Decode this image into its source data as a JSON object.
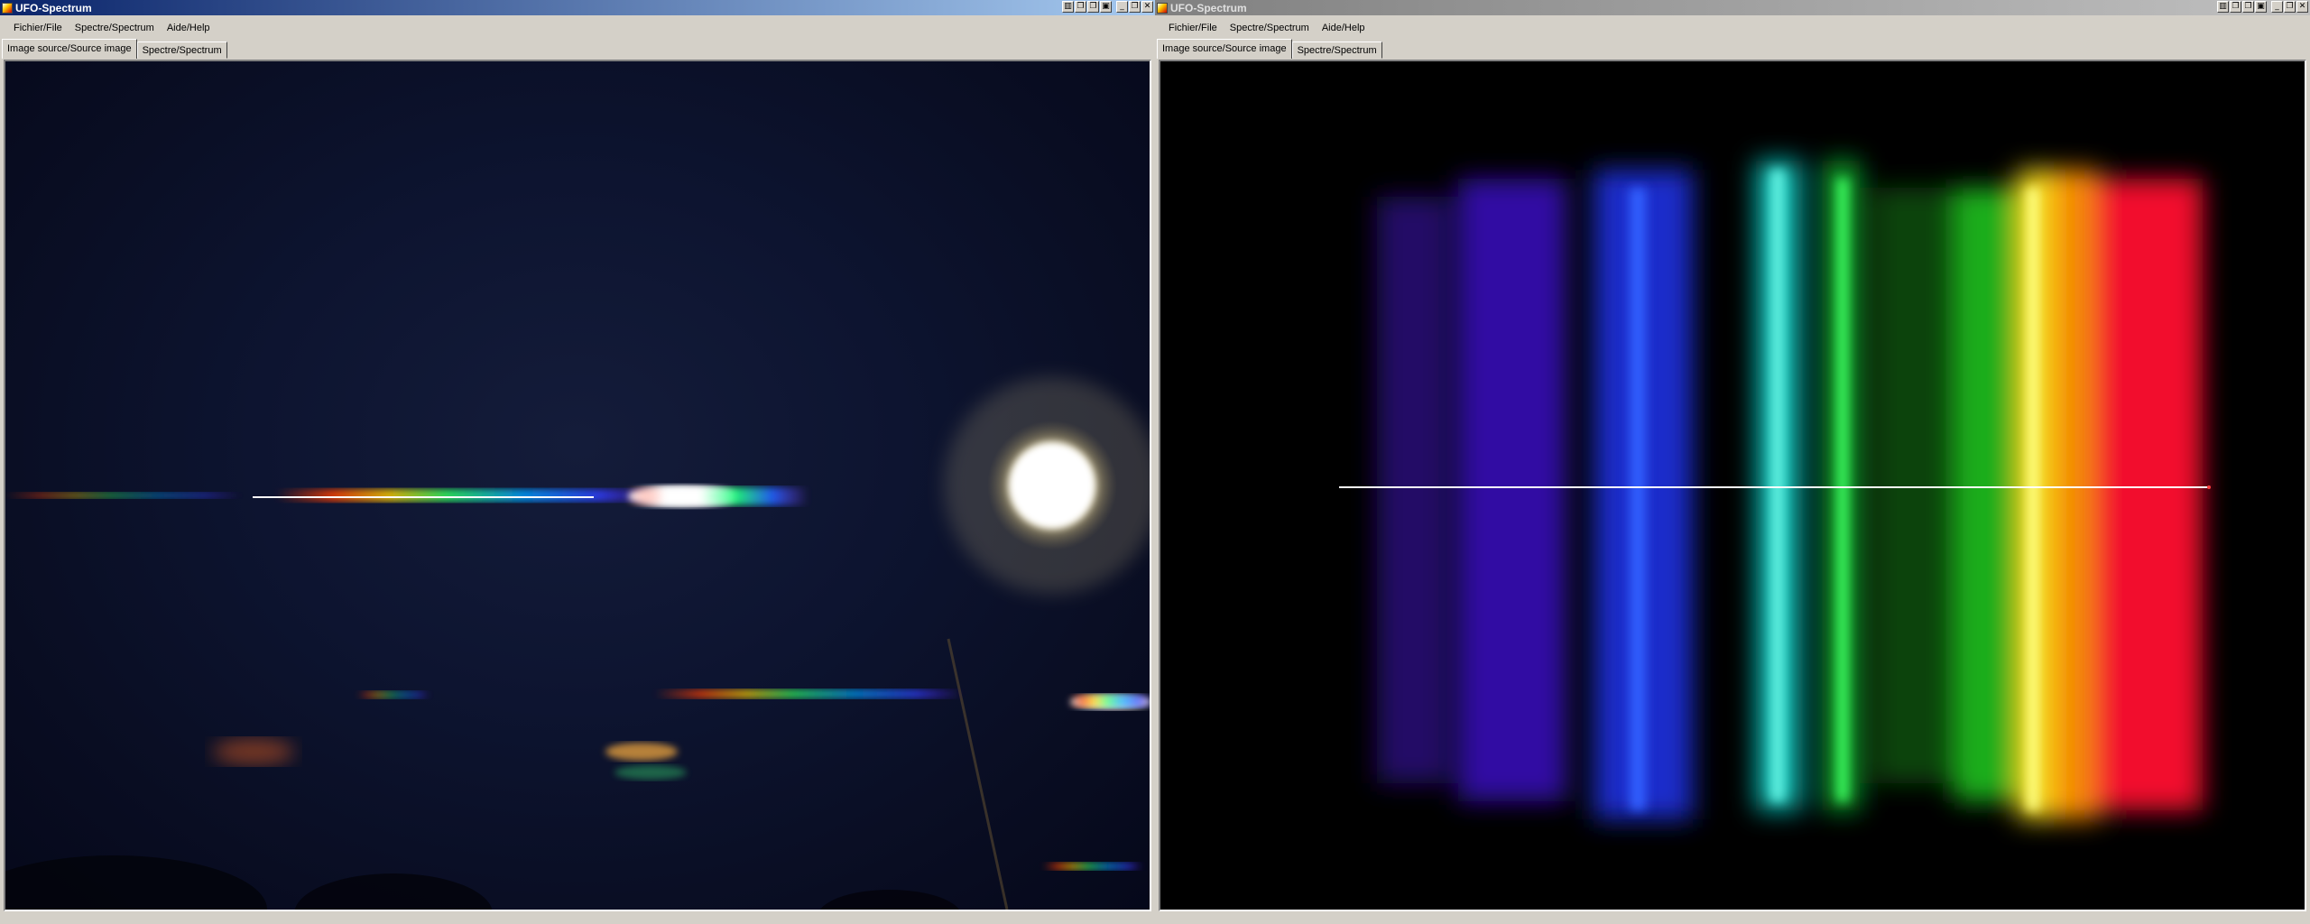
{
  "windows": [
    {
      "title": "UFO-Spectrum",
      "active": true,
      "menu": [
        "Fichier/File",
        "Spectre/Spectrum",
        "Aide/Help"
      ],
      "tabs": [
        "Image source/Source image",
        "Spectre/Spectrum"
      ],
      "selected_tab": 0
    },
    {
      "title": "UFO-Spectrum",
      "active": false,
      "menu": [
        "Fichier/File",
        "Spectre/Spectrum",
        "Aide/Help"
      ],
      "tabs": [
        "Image source/Source image",
        "Spectre/Spectrum"
      ],
      "selected_tab": 0
    }
  ],
  "icons": {
    "app": "ufo-spectrum-app-icon",
    "window_controls": [
      "tile-icon",
      "cascade-icon",
      "restore-icon",
      "restore-icon",
      "minimize-icon",
      "restore-icon",
      "close-icon"
    ]
  },
  "colors": {
    "active_title": "#0a246a",
    "inactive_title": "#808080",
    "chrome": "#d4d0c8",
    "measure_line": "#ffffff"
  }
}
